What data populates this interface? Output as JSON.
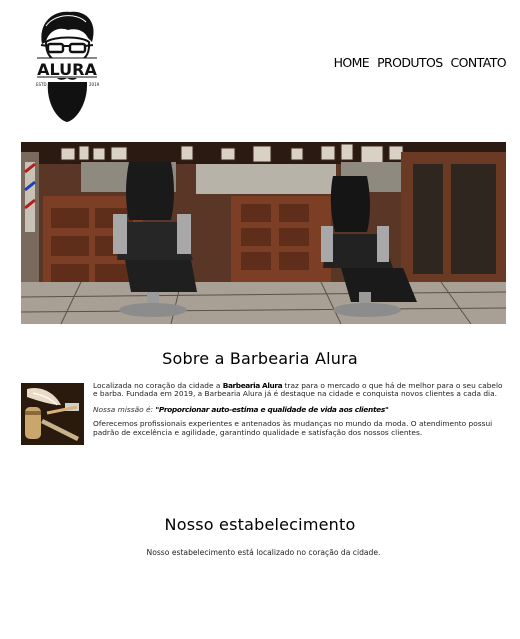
{
  "header": {
    "logo": {
      "brand": "ALURA",
      "est": "ESTD",
      "year": "2019",
      "alt": "alura-barbearia-logo"
    },
    "nav": [
      {
        "label": "HOME"
      },
      {
        "label": "PRODUTOS"
      },
      {
        "label": "CONTATO"
      }
    ]
  },
  "banner": {
    "alt": "barbershop-interior-photo"
  },
  "about": {
    "title": "Sobre a Barbearia Alura",
    "image_alt": "shaving-brush-and-razor-photo",
    "paragraph1_before": "Localizada no coração da cidade a ",
    "paragraph1_brand": "Barbearia Alura",
    "paragraph1_after": " traz para o mercado o que há de melhor para o seu cabelo e barba. Fundada em 2019, a Barbearia Alura já é destaque na cidade e conquista novos clientes a cada dia.",
    "mission_label": "Nossa missão é: ",
    "mission_text": "\"Proporcionar auto-estima e qualidade de vida aos clientes\"",
    "paragraph2": "Oferecemos profissionais experientes e antenados às mudanças no mundo da moda. O atendimento possui padrão de excelência e agilidade, garantindo qualidade e satisfação dos nossos clientes."
  },
  "establishment": {
    "title": "Nosso estabelecimento",
    "description": "Nosso estabelecimento está localizado no coração da cidade."
  }
}
